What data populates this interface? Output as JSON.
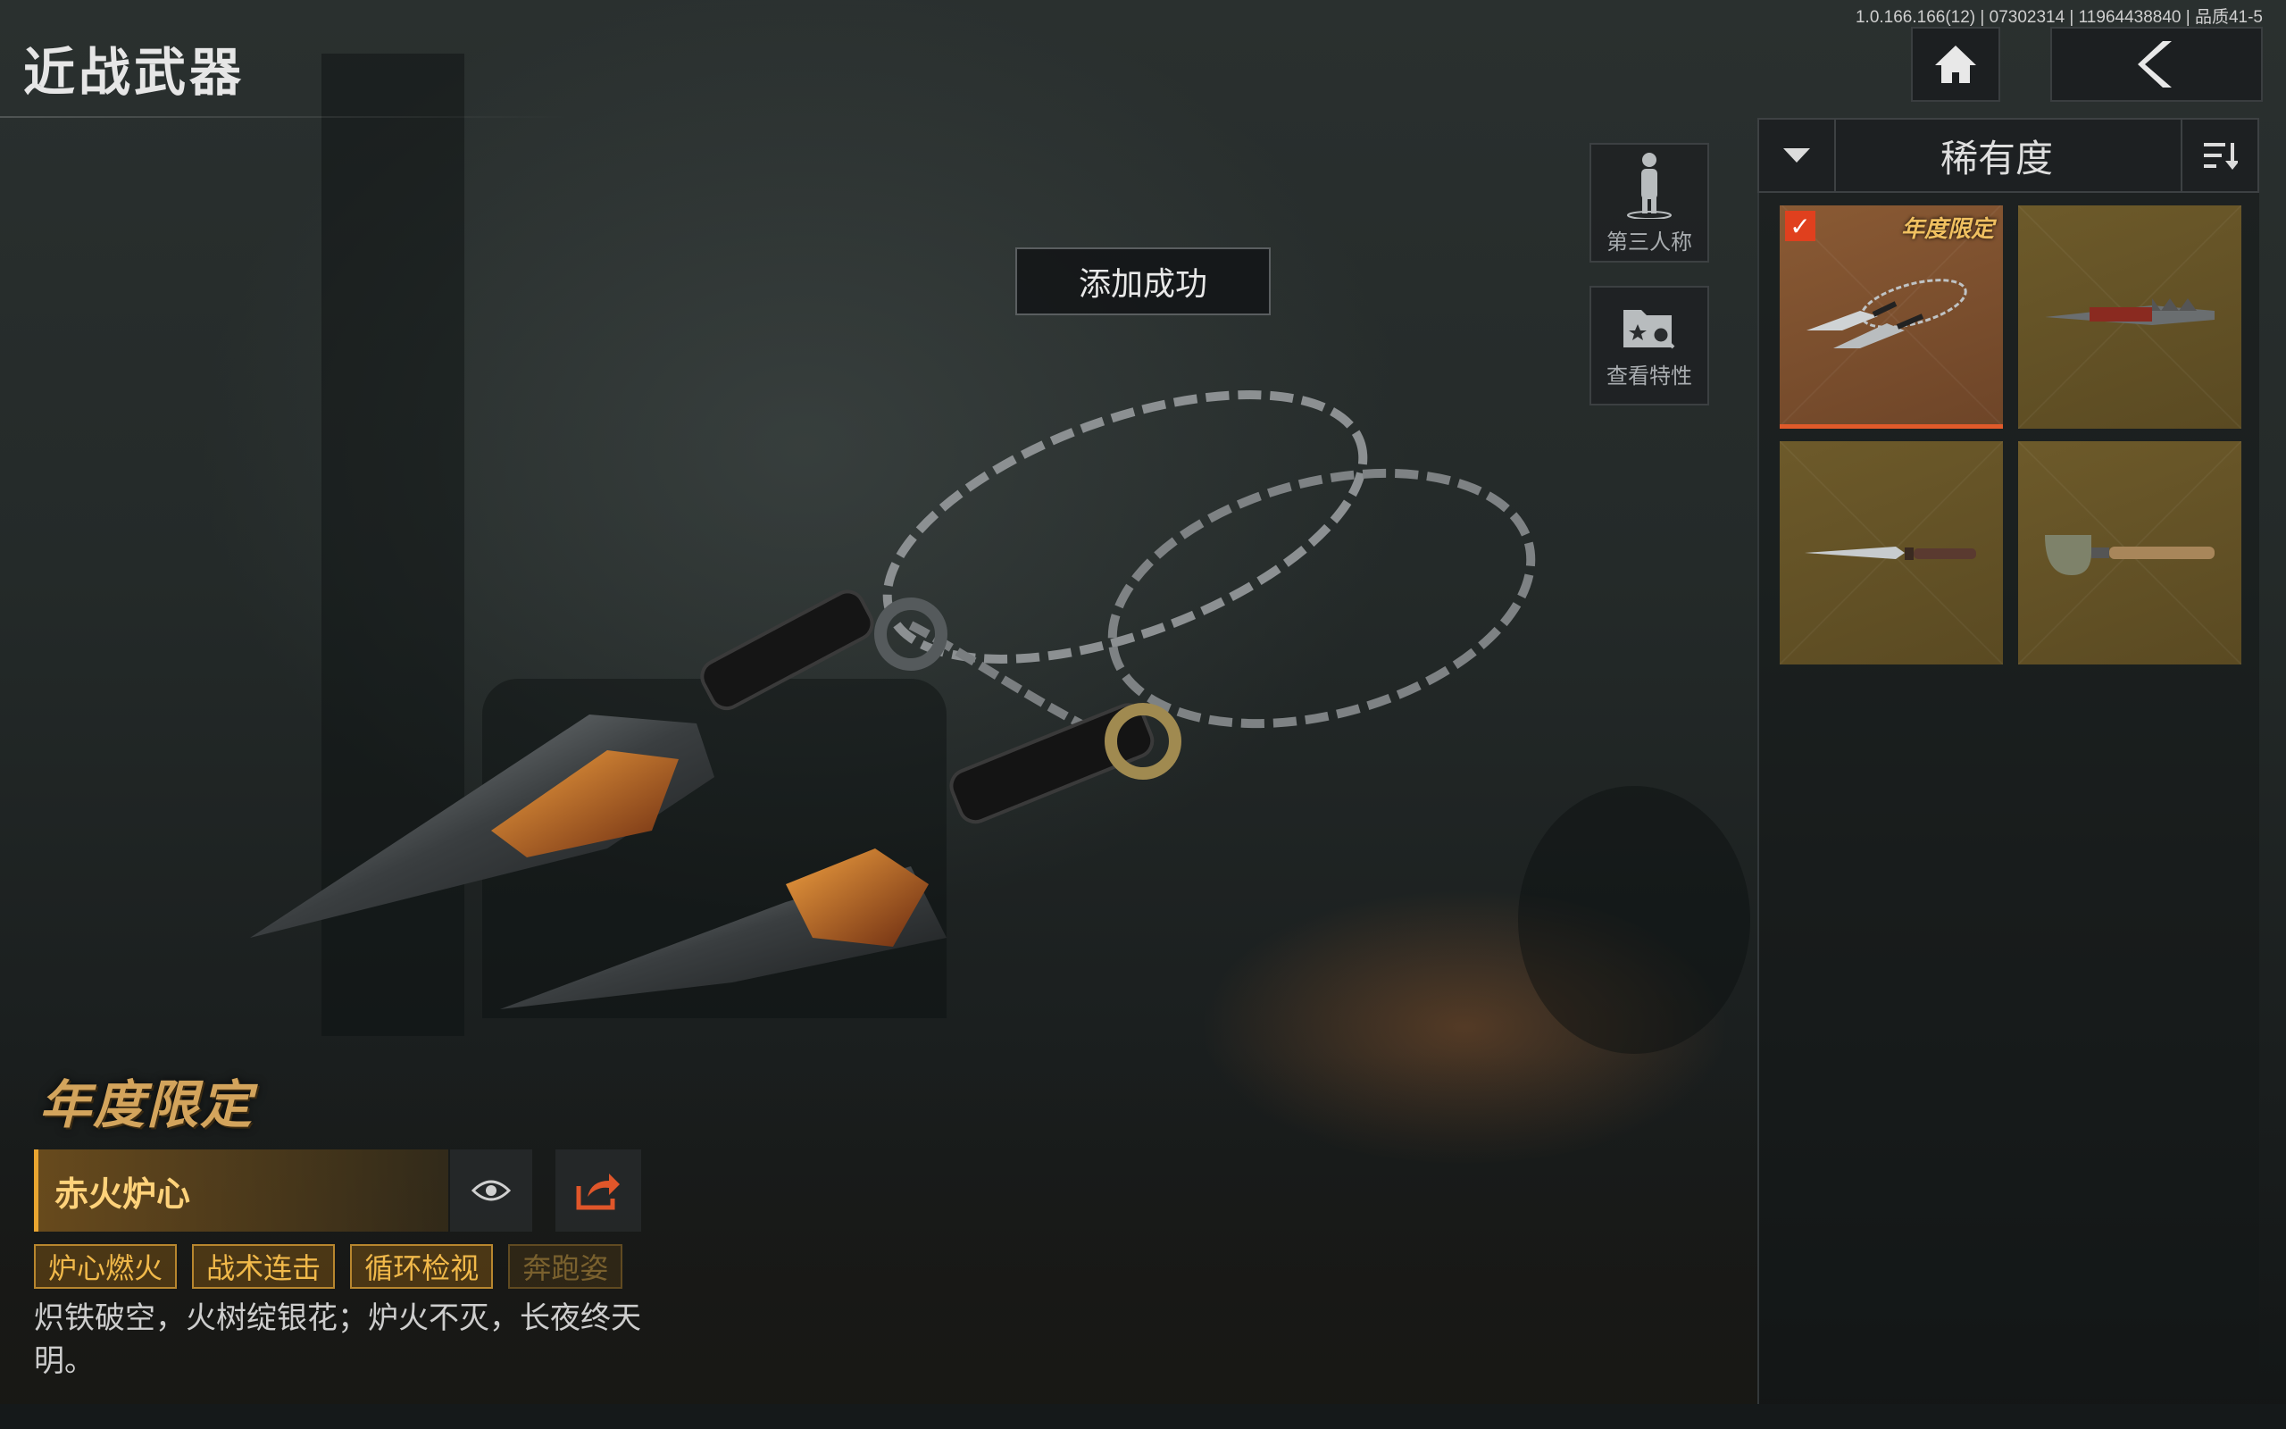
{
  "header": {
    "title": "近战武器",
    "version_info": "1.0.166.166(12) | 07302314 | 11964438840 | 品质41-5"
  },
  "top_buttons": {
    "home_icon": "home-icon",
    "back_icon": "chevron-left-icon"
  },
  "side_buttons": {
    "third_person_label": "第三人称",
    "view_traits_label": "查看特性"
  },
  "toast": "添加成功",
  "sort": {
    "label": "稀有度"
  },
  "grid": [
    {
      "badge": "年度限定",
      "selected": true,
      "style": "selected",
      "weapon_icon": "kunai-chain-icon"
    },
    {
      "badge": "",
      "selected": false,
      "style": "gold",
      "weapon_icon": "spiked-blade-icon"
    },
    {
      "badge": "",
      "selected": false,
      "style": "gold",
      "weapon_icon": "dagger-icon"
    },
    {
      "badge": "",
      "selected": false,
      "style": "gold",
      "weapon_icon": "shovel-icon"
    }
  ],
  "weapon": {
    "limited_logo": "年度限定",
    "name": "赤火炉心",
    "tags": [
      "炉心燃火",
      "战术连击",
      "循环检视",
      "奔跑姿"
    ],
    "description": "炽铁破空，火树绽银花；炉火不灭，长夜终天明。"
  },
  "colors": {
    "accent": "#e9a530",
    "selected_border": "#e05a2a",
    "check": "#e0401e"
  }
}
